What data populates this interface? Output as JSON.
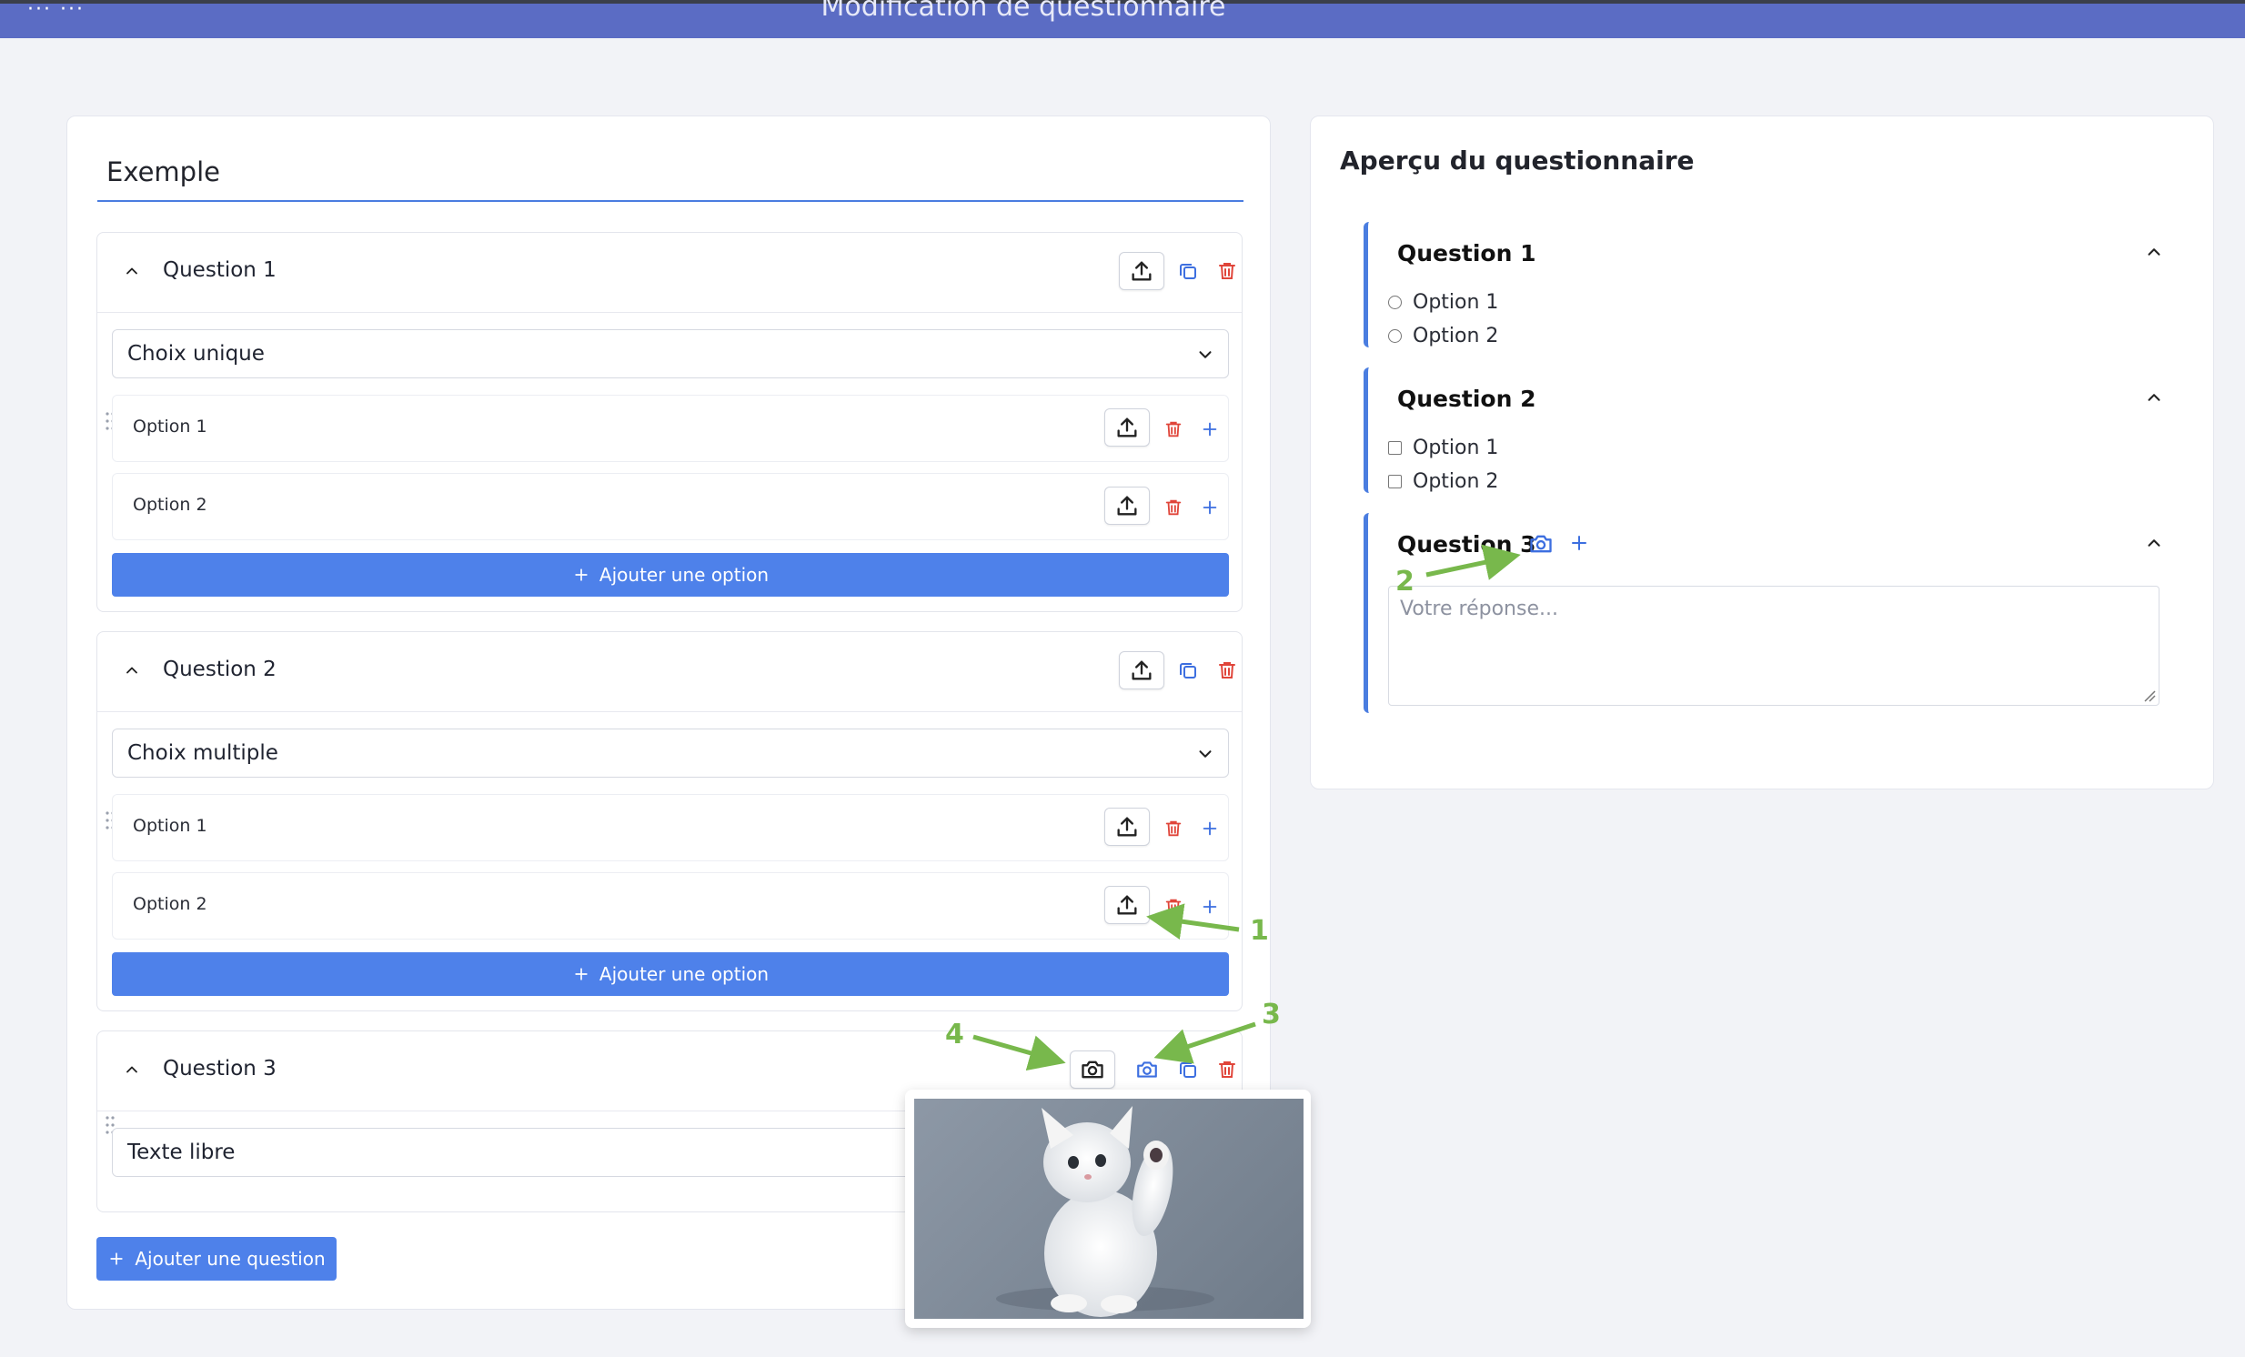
{
  "header": {
    "title": "Modification de questionnaire",
    "menu_glyph": "··· ···"
  },
  "editor": {
    "form_title": "Exemple",
    "questions": [
      {
        "title": "Question 1",
        "type": "Choix unique",
        "options": [
          {
            "label": "Option 1"
          },
          {
            "label": "Option 2"
          }
        ],
        "add_option_label": "Ajouter une option"
      },
      {
        "title": "Question 2",
        "type": "Choix multiple",
        "options": [
          {
            "label": "Option 1"
          },
          {
            "label": "Option 2"
          }
        ],
        "add_option_label": "Ajouter une option"
      },
      {
        "title": "Question 3",
        "type": "Texte libre"
      }
    ],
    "add_question_label": "Ajouter une question"
  },
  "preview": {
    "title": "Aperçu du questionnaire",
    "questions": [
      {
        "title": "Question 1",
        "input": "radio",
        "options": [
          "Option 1",
          "Option 2"
        ]
      },
      {
        "title": "Question 2",
        "input": "checkbox",
        "options": [
          "Option 1",
          "Option 2"
        ]
      },
      {
        "title": "Question 3",
        "input": "textarea",
        "placeholder": "Votre réponse..."
      }
    ]
  },
  "annotations": [
    "1",
    "2",
    "3",
    "4"
  ],
  "icons": {
    "upload": "upload-icon",
    "copy": "copy-icon",
    "delete": "trash-icon",
    "add": "plus-icon",
    "camera": "camera-icon",
    "chevron_up": "chevron-up-icon",
    "chevron_down": "chevron-down-icon",
    "drag": "drag-handle-icon"
  },
  "colors": {
    "accent": "#4e81ea",
    "header": "#5b6cc4",
    "danger": "#e0453a",
    "annotation": "#78b84c"
  }
}
